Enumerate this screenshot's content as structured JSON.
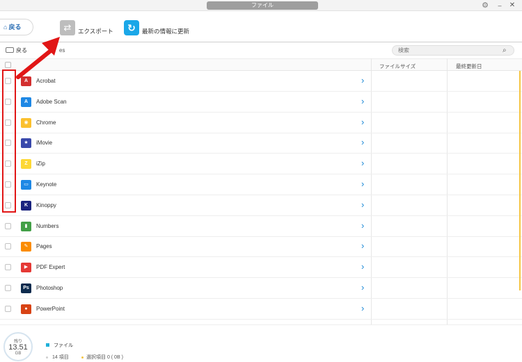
{
  "window": {
    "title": "ファイル",
    "icons": {
      "settings": "gear-icon",
      "minimize": "minimize-icon",
      "close": "close-icon"
    }
  },
  "toolbar": {
    "back_label": "戻る",
    "export_label": "エクスポート",
    "refresh_label": "最新の情報に更新"
  },
  "subbar": {
    "back_label": "戻る",
    "path_tail": "es",
    "search_placeholder": "検索"
  },
  "table": {
    "columns": {
      "size": "ファイルサイズ",
      "modified": "最終更新日"
    },
    "rows": [
      {
        "name": "Acrobat",
        "icon": "acrobat-icon",
        "color": "#d32f2f",
        "glyph": "A"
      },
      {
        "name": "Adobe Scan",
        "icon": "adobe-scan-icon",
        "color": "#1e88e5",
        "glyph": "A"
      },
      {
        "name": "Chrome",
        "icon": "chrome-icon",
        "color": "#fbc02d",
        "glyph": "◉"
      },
      {
        "name": "iMovie",
        "icon": "imovie-icon",
        "color": "#3949ab",
        "glyph": "★"
      },
      {
        "name": "iZip",
        "icon": "izip-icon",
        "color": "#fdd835",
        "glyph": "Z"
      },
      {
        "name": "Keynote",
        "icon": "keynote-icon",
        "color": "#1e88e5",
        "glyph": "▭"
      },
      {
        "name": "Kinoppy",
        "icon": "kinoppy-icon",
        "color": "#1a237e",
        "glyph": "K"
      },
      {
        "name": "Numbers",
        "icon": "numbers-icon",
        "color": "#43a047",
        "glyph": "▮"
      },
      {
        "name": "Pages",
        "icon": "pages-icon",
        "color": "#fb8c00",
        "glyph": "✎"
      },
      {
        "name": "PDF Expert",
        "icon": "pdf-expert-icon",
        "color": "#e53935",
        "glyph": "▶"
      },
      {
        "name": "Photoshop",
        "icon": "photoshop-icon",
        "color": "#0d2b4e",
        "glyph": "Ps"
      },
      {
        "name": "PowerPoint",
        "icon": "powerpoint-icon",
        "color": "#d84315",
        "glyph": "●"
      }
    ]
  },
  "footer": {
    "storage_label": "残り",
    "storage_value": "13.51",
    "storage_unit": "GB",
    "legend_files": "ファイル",
    "item_count": "14 項目",
    "selected": "選択項目 0 ( 0B )"
  },
  "colors": {
    "accent_blue": "#1aa7e8",
    "chevron": "#1a88d6",
    "annotation_red": "#e11616",
    "scroll_accent": "#f5c542"
  }
}
